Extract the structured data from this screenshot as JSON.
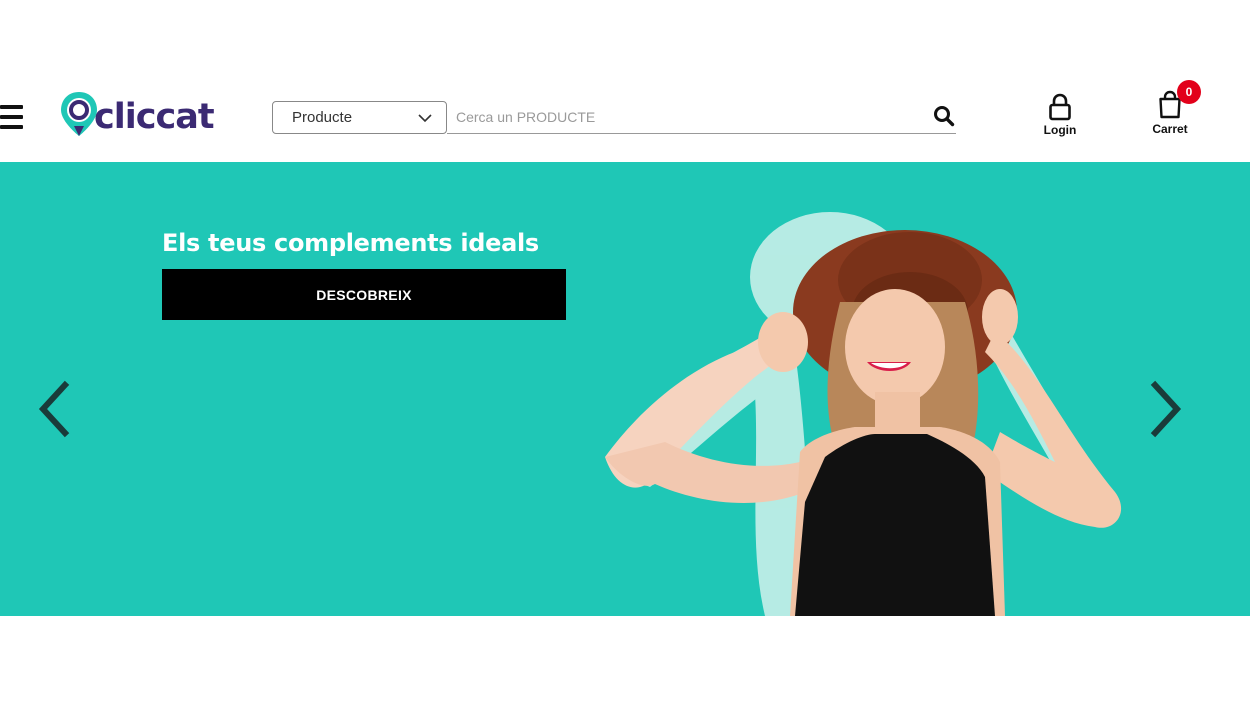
{
  "header": {
    "brand": "cliccat",
    "category_select": {
      "value": "Producte"
    },
    "search": {
      "placeholder": "Cerca un PRODUCTE",
      "value": ""
    },
    "login_label": "Login",
    "cart": {
      "label": "Carret",
      "count": "0"
    }
  },
  "hero": {
    "title": "Els teus complements ideals",
    "cta_label": "DESCOBREIX",
    "background_color": "#1fc7b6",
    "image": "woman-with-brown-hat"
  },
  "colors": {
    "brand_purple": "#3b2a73",
    "brand_teal": "#1fc7b6",
    "badge_red": "#e2001a"
  },
  "icons": {
    "menu": "hamburger-icon",
    "search": "search-icon",
    "login": "user-lock-icon",
    "cart": "shopping-bag-icon",
    "prev": "chevron-left-icon",
    "next": "chevron-right-icon"
  }
}
